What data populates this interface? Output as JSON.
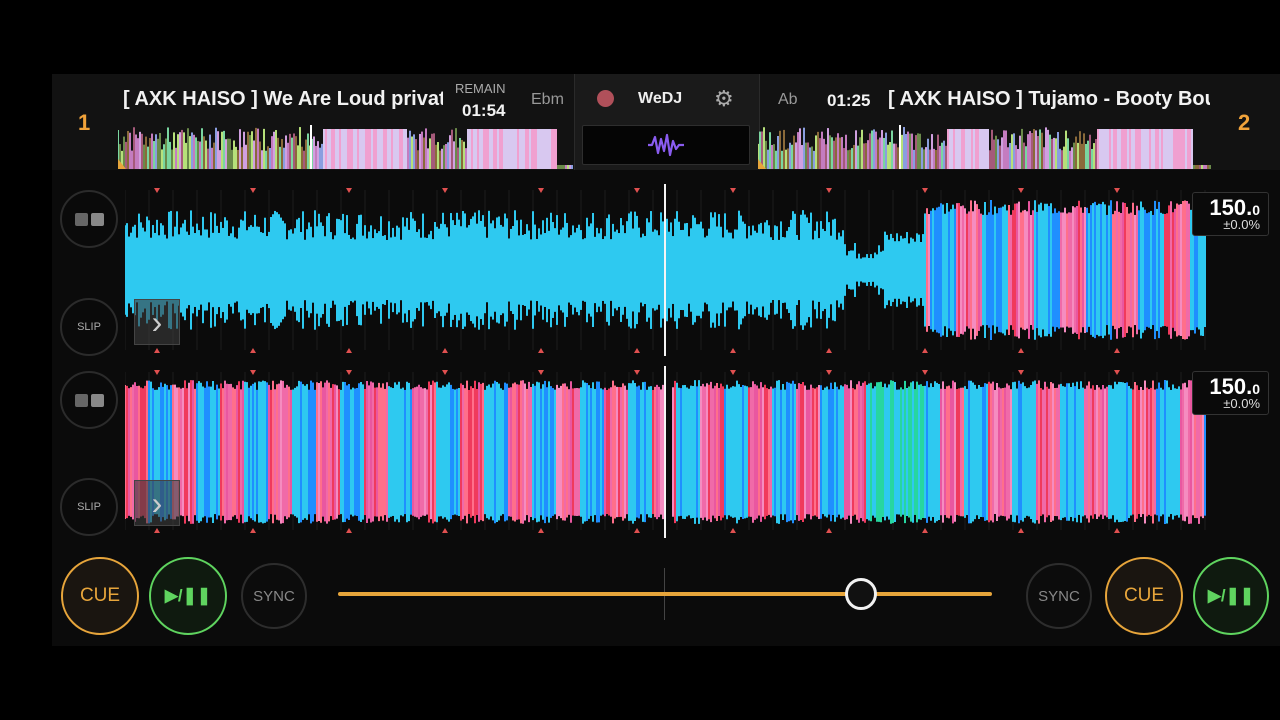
{
  "app": {
    "name": "WeDJ"
  },
  "deck1": {
    "number": "1",
    "title": "[ AXK HAISO ] We Are Loud private",
    "remain_label": "REMAIN",
    "remain_time": "01:54",
    "key": "Ebm",
    "bpm": "150.",
    "bpm_decimal": "0",
    "pitch": "±0.0%",
    "slip_label": "SLIP",
    "cue_label": "CUE",
    "play_label": "▶/❚❚",
    "sync_label": "SYNC"
  },
  "deck2": {
    "number": "2",
    "title": "[ AXK HAISO ] Tujamo - Booty Bou",
    "time": "01:25",
    "key": "Ab",
    "bpm": "150.",
    "bpm_decimal": "0",
    "pitch": "±0.0%",
    "slip_label": "SLIP",
    "cue_label": "CUE",
    "play_label": "▶/❚❚",
    "sync_label": "SYNC"
  },
  "crossfader": {
    "position_fraction": 0.8
  },
  "colors": {
    "accent": "#e7a53b",
    "play": "#5fd45f",
    "wave_blue": "#2ec9f0",
    "wave_pink": "#f06aa8",
    "wave_red": "#f03a5c"
  },
  "icons": {
    "record": "record-dot-icon",
    "settings": "gear-icon",
    "waveform": "waveform-icon",
    "expand": "chevron-right-icon",
    "hotcue": "hotcue-pads-icon"
  }
}
